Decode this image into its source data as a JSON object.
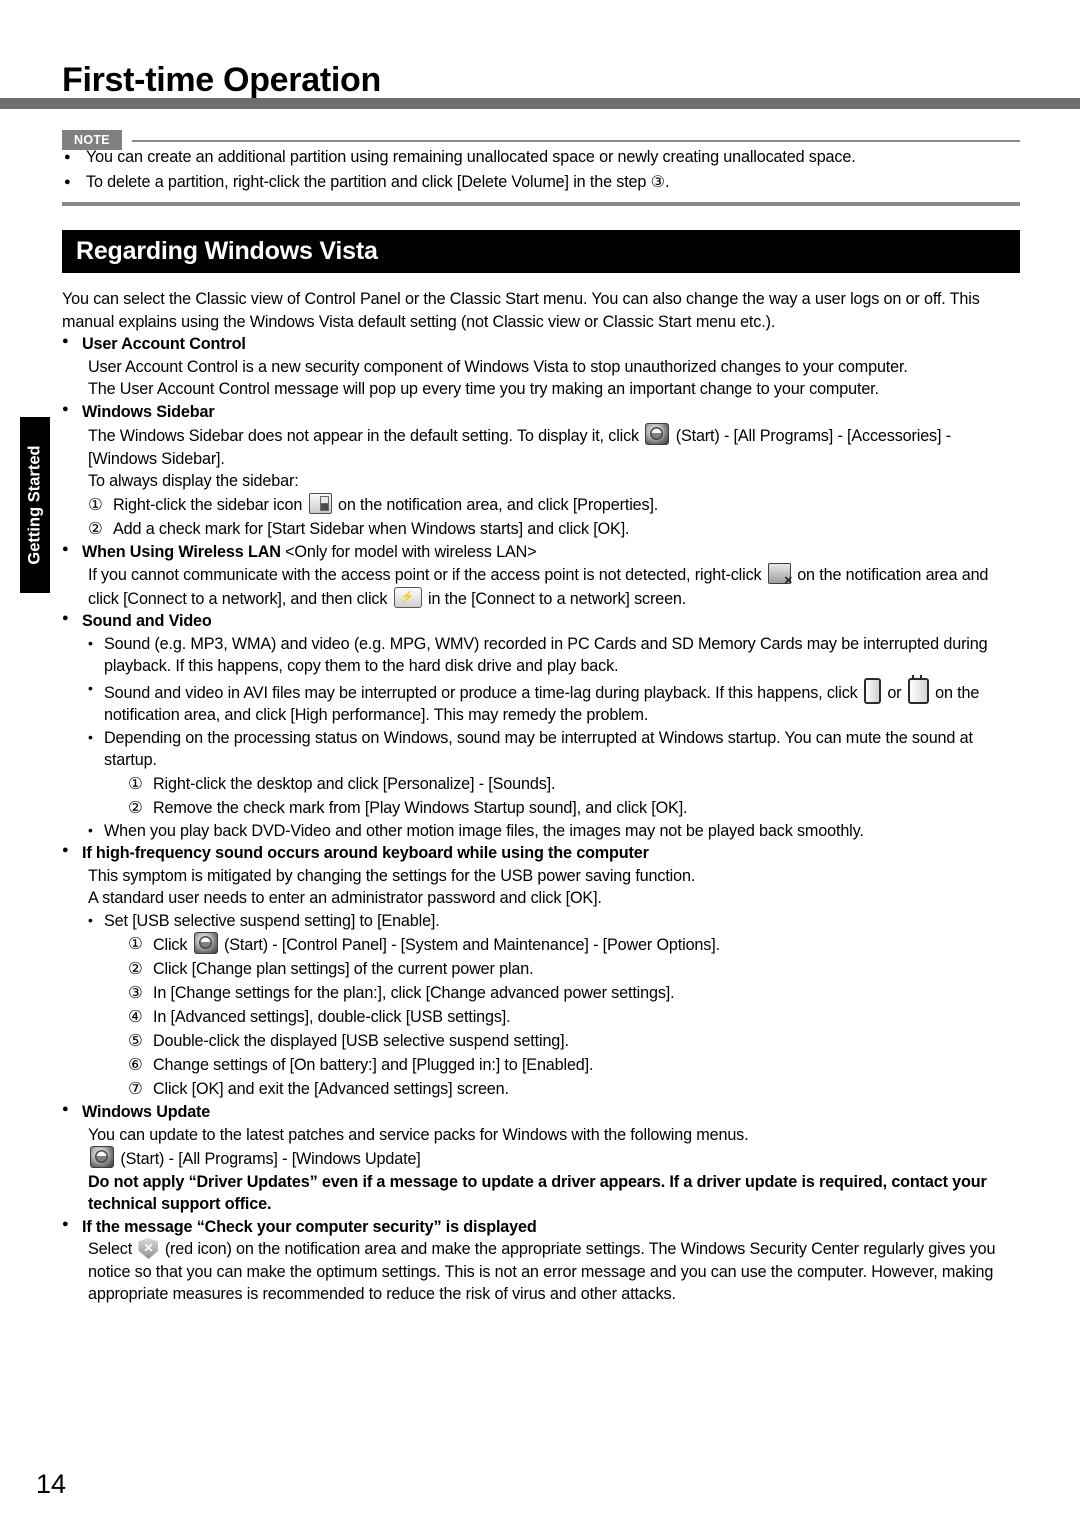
{
  "header": {
    "title": "First-time Operation"
  },
  "side_tab": {
    "label": "Getting Started"
  },
  "note": {
    "badge": "NOTE",
    "items": [
      "You can create an additional partition using remaining unallocated space or newly creating unallocated space.",
      "To delete a partition, right-click the partition and click [Delete Volume] in the step ③."
    ]
  },
  "section": {
    "banner": "Regarding Windows Vista",
    "intro": "You can select the Classic view of Control Panel or the Classic Start menu. You can also change the way a user logs on or off. This manual explains using the Windows Vista default setting (not Classic view or Classic Start menu etc.)."
  },
  "uac": {
    "heading": "User Account Control",
    "line1": "User Account Control is a new security component of Windows Vista to stop unauthorized changes to your computer.",
    "line2": "The User Account Control message will pop up every time you try making an important change to your computer."
  },
  "sidebar": {
    "heading": "Windows Sidebar",
    "line1_pre": "The Windows Sidebar does not appear in the default setting. To display it, click",
    "line1_post": "(Start) - [All Programs] - [Accessories] - [Windows Sidebar].",
    "line2": "To always display the sidebar:",
    "steps": [
      {
        "num": "①",
        "pre": "Right-click the sidebar icon",
        "post": "on the notification area, and click [Properties]."
      },
      {
        "num": "②",
        "pre": "Add a check mark for [Start Sidebar when Windows starts] and click [OK].",
        "post": ""
      }
    ]
  },
  "wireless": {
    "heading_bold": "When Using Wireless LAN",
    "heading_reg": " <Only for model with wireless LAN>",
    "body_pre": "If you cannot communicate with the access point or if the access point is not detected, right-click",
    "body_mid": "on the notification area and click [Connect to a network], and then click",
    "body_post": "in the [Connect to a network] screen."
  },
  "sound_video": {
    "heading": "Sound and Video",
    "bullets": [
      {
        "text": "Sound (e.g. MP3, WMA) and video (e.g. MPG, WMV) recorded in PC Cards and SD Memory Cards may be interrupted during playback. If this happens, copy them to the hard disk drive and play back."
      },
      {
        "pre": "Sound and video in AVI files may be interrupted or produce a time-lag during playback. If this happens, click",
        "mid": "or",
        "post": "on the notification area, and click [High performance]. This may remedy the problem."
      },
      {
        "text": "Depending on the processing status on Windows, sound may be interrupted at Windows startup. You can mute the sound at startup.",
        "steps": [
          {
            "num": "①",
            "text": "Right-click the desktop and click [Personalize] - [Sounds]."
          },
          {
            "num": "②",
            "text": "Remove the check mark from [Play Windows Startup sound], and click [OK]."
          }
        ]
      },
      {
        "text": "When you play back DVD-Video and other motion image files, the images may not be played back smoothly."
      }
    ]
  },
  "high_freq": {
    "heading": "If high-frequency sound occurs around keyboard while using the computer",
    "line1": "This symptom is mitigated by changing the settings for the USB power saving function.",
    "line2": "A standard user needs to enter an administrator password and click [OK].",
    "bullet": "Set [USB selective suspend setting] to [Enable].",
    "steps": [
      {
        "num": "①",
        "pre": "Click",
        "post": "(Start) - [Control Panel] - [System and Maintenance] - [Power Options]."
      },
      {
        "num": "②",
        "pre": "Click [Change plan settings] of the current power plan.",
        "post": ""
      },
      {
        "num": "③",
        "pre": "In [Change settings for the plan:], click [Change advanced power settings].",
        "post": ""
      },
      {
        "num": "④",
        "pre": "In [Advanced settings], double-click [USB settings].",
        "post": ""
      },
      {
        "num": "⑤",
        "pre": "Double-click the displayed [USB selective suspend setting].",
        "post": ""
      },
      {
        "num": "⑥",
        "pre": "Change settings of [On battery:] and [Plugged in:] to [Enabled].",
        "post": ""
      },
      {
        "num": "⑦",
        "pre": "Click [OK] and exit the [Advanced settings] screen.",
        "post": ""
      }
    ]
  },
  "windows_update": {
    "heading": "Windows Update",
    "line1": "You can update to the latest patches and service packs for Windows with the following menus.",
    "line2_post": "(Start) - [All Programs] - [Windows Update]",
    "warning": "Do not apply “Driver Updates” even if a message to update a driver appears. If a driver update is required, contact your technical support office."
  },
  "security": {
    "heading": "If the message “Check your computer security” is displayed",
    "body_pre": "Select",
    "body_post": "(red icon) on the notification area and make the appropriate settings. The Windows Security Center regularly gives you notice so that you can make the optimum settings. This is not an error message and you can use the computer. However, making appropriate measures is recommended to reduce the risk of virus and other attacks."
  },
  "footer": {
    "page_number": "14"
  },
  "colors": {
    "rule_gray": "#6e6e6e",
    "banner_black": "#000000",
    "badge_gray": "#808080"
  }
}
